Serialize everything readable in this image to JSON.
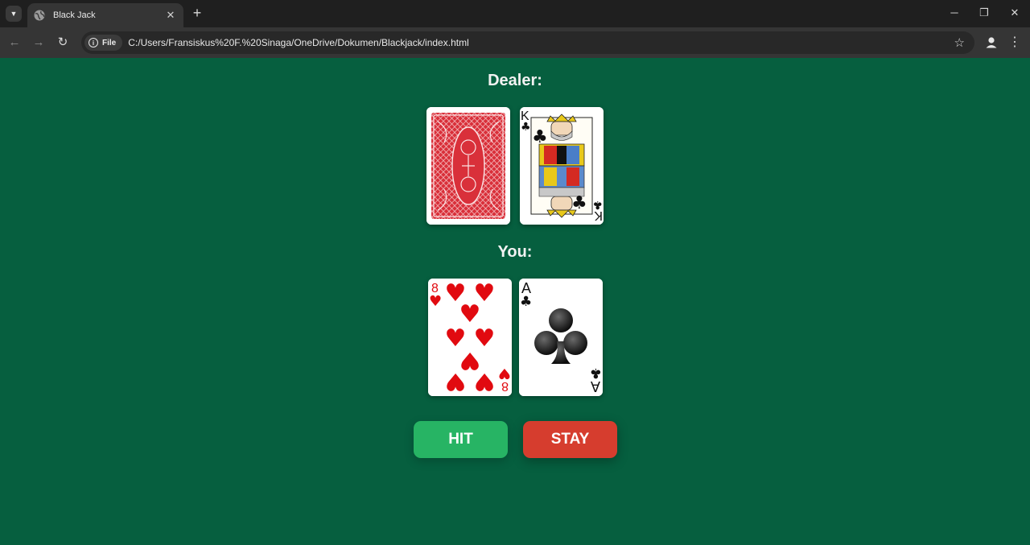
{
  "browser": {
    "tab_title": "Black Jack",
    "chip_label": "File",
    "url": "C:/Users/Fransiskus%20F.%20Sinaga/OneDrive/Dokumen/Blackjack/index.html"
  },
  "game": {
    "dealer_label": "Dealer:",
    "player_label": "You:",
    "dealer_cards": [
      {
        "type": "back",
        "color": "#d9303a"
      },
      {
        "type": "face",
        "rank": "K",
        "suit": "clubs",
        "suit_symbol": "♣",
        "color": "#111111"
      }
    ],
    "player_cards": [
      {
        "rank": "8",
        "suit": "hearts",
        "suit_symbol": "♥",
        "color": "#e10a10"
      },
      {
        "rank": "A",
        "suit": "clubs",
        "suit_symbol": "♣",
        "color": "#111111"
      }
    ],
    "buttons": {
      "hit_label": "HIT",
      "stay_label": "STAY"
    }
  },
  "colors": {
    "table_green": "#065f3f",
    "hit_button": "#27b464",
    "stay_button": "#d63d2e"
  }
}
